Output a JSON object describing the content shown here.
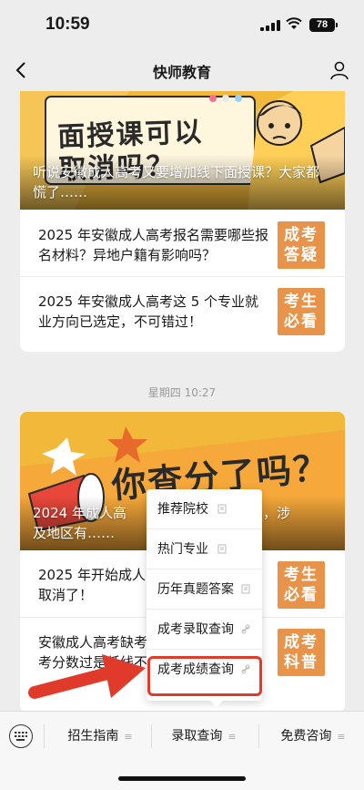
{
  "status": {
    "time": "10:59",
    "battery": "78"
  },
  "nav": {
    "title": "快师教育"
  },
  "cards": [
    {
      "hero_title": "听说安徽成人高考又要增加线下面授课？大家都慌了……",
      "hero_art_text": "面授课可以取消吗？",
      "items": [
        {
          "text": "2025 年安徽成人高考报名需要哪些报名材料？异地户籍有影响吗？",
          "thumb": [
            "成考",
            "答疑"
          ]
        },
        {
          "text": "2025 年安徽成人高考这 5 个专业就业方向已选定，不可错过！",
          "thumb": [
            "考生",
            "必看"
          ]
        }
      ]
    },
    {
      "timestamp": "星期四 10:27",
      "hero_title": "2024 年成人高考……公布，涉及地区有……",
      "hero_title_line1": "2024 年成人高",
      "hero_title_line1b": "公布，涉",
      "hero_title_line2": "及地区有……",
      "hero_art_text": "你查分了吗？",
      "items": [
        {
          "text_line1": "2025 年开始成人",
          "text_line2": "取消了！",
          "thumb": [
            "考生",
            "必看"
          ]
        },
        {
          "text_line1": "安徽成人高考缺考",
          "text_line2": "考分数过是低线不",
          "thumb": [
            "成考",
            "科普"
          ]
        }
      ]
    }
  ],
  "popup_menu": {
    "items": [
      {
        "label": "推荐院校",
        "icon": "article-icon"
      },
      {
        "label": "热门专业",
        "icon": "article-icon"
      },
      {
        "label": "历年真题答案",
        "icon": "article-icon"
      },
      {
        "label": "成考录取查询",
        "icon": "link-icon"
      },
      {
        "label": "成考成绩查询",
        "icon": "link-icon"
      }
    ]
  },
  "bottom_menu": {
    "tabs": [
      {
        "label": "招生指南"
      },
      {
        "label": "录取查询"
      },
      {
        "label": "免费咨询"
      }
    ]
  },
  "colors": {
    "highlight": "#e03a2a",
    "hero_bg": "#f2b83a",
    "thumb_bg": "#e8934a"
  }
}
